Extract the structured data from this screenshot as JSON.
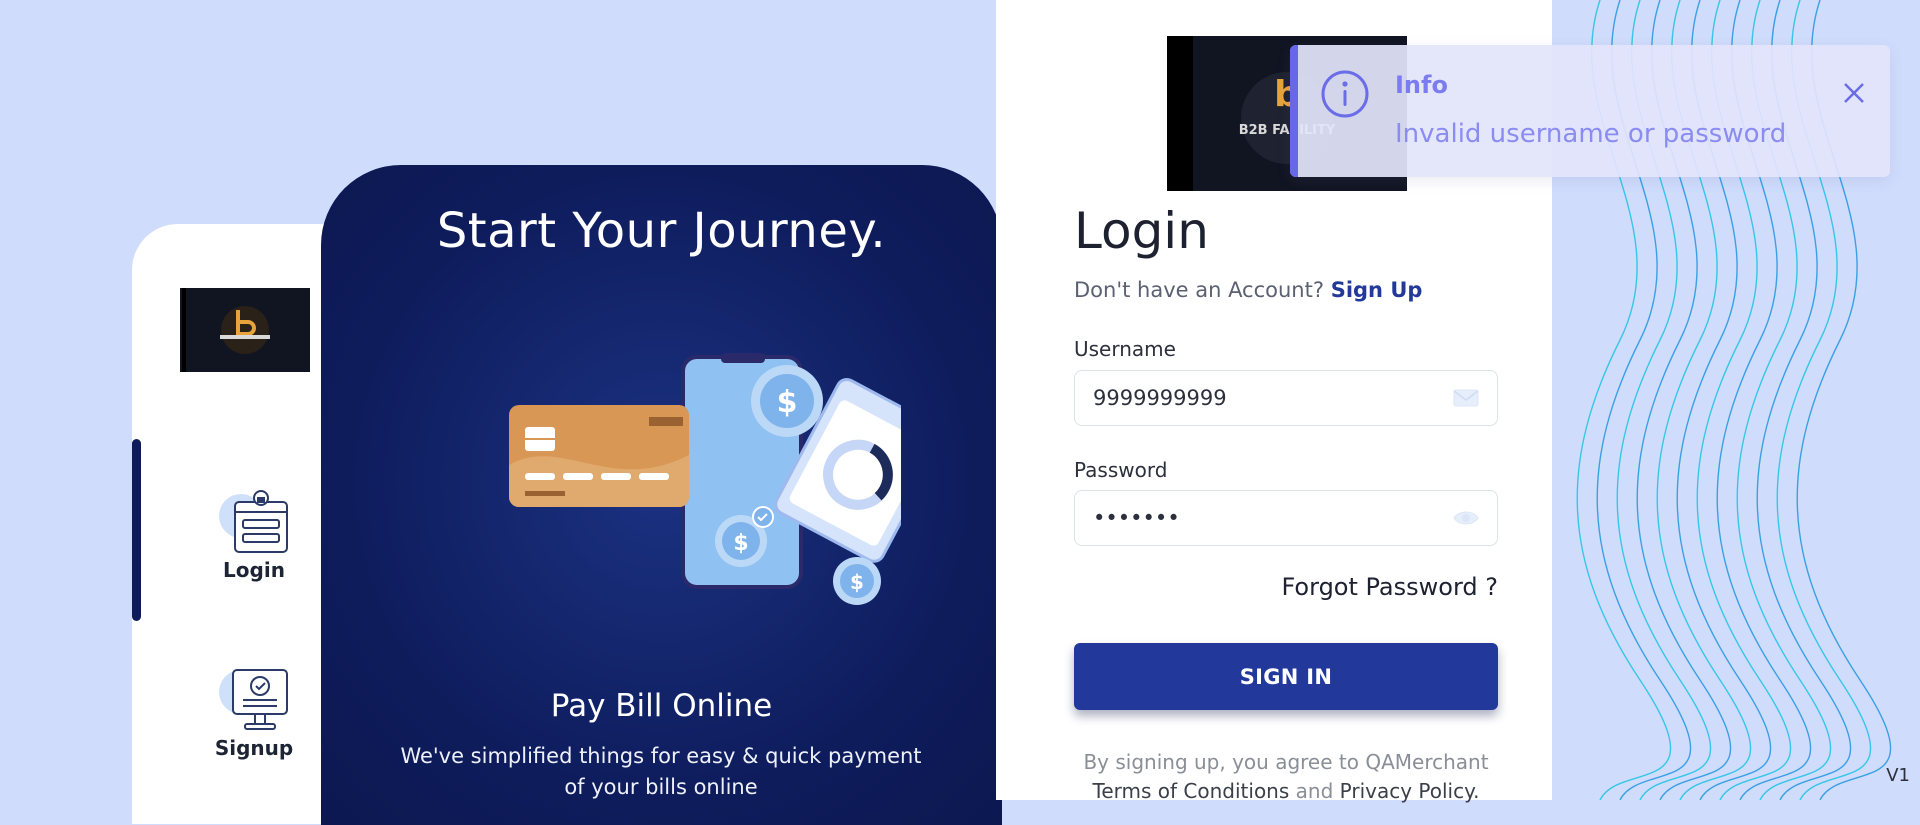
{
  "nav": {
    "logo_icon": "b2b-facility-logo",
    "items": [
      {
        "label": "Login",
        "icon": "login-form-icon"
      },
      {
        "label": "Signup",
        "icon": "signup-monitor-icon"
      }
    ]
  },
  "hero": {
    "title": "Start Your Journey.",
    "illustration": "card-phone-payment-illustration",
    "subtitle": "Pay Bill Online",
    "description": "We've simplified things for easy & quick payment of your bills online"
  },
  "login": {
    "brand_logo_text": "B2B FACILITY",
    "title": "Login",
    "signup_prompt": "Don't have an Account?",
    "signup_link": "Sign Up",
    "username_label": "Username",
    "username_value": "9999999999",
    "password_label": "Password",
    "password_value": "•••••••",
    "forgot_password": "Forgot Password ?",
    "signin_button": "SIGN IN",
    "terms_prefix": "By signing up, you agree to QAMerchant",
    "terms_link": "Terms of Conditions",
    "terms_and": "and",
    "privacy_link": "Privacy Policy."
  },
  "toast": {
    "title": "Info",
    "message": "Invalid username or password",
    "icon": "info-circle-icon"
  },
  "version": "V1",
  "colors": {
    "page_bg": "#d0dcfc",
    "hero_bg": "#0e1c5c",
    "primary_button": "#22399b",
    "signup_link": "#23399a",
    "toast_accent": "#6668e8",
    "nav_indicator": "#0f1c5a"
  }
}
